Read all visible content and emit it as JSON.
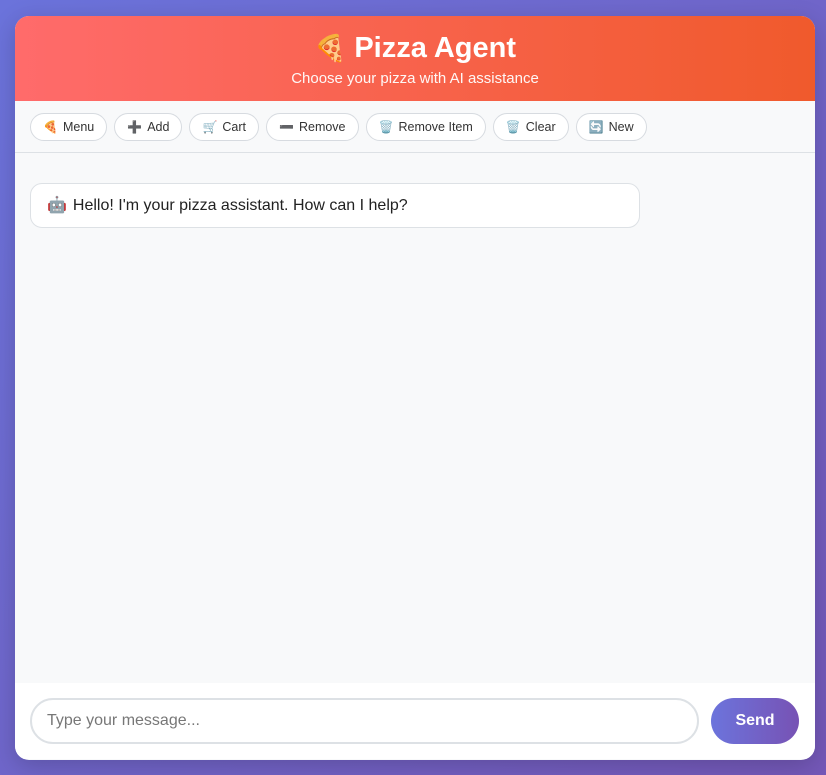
{
  "header": {
    "icon": "pizza-icon",
    "icon_glyph": "🍕",
    "title": "Pizza Agent",
    "subtitle": "Choose your pizza with AI assistance"
  },
  "toolbar": {
    "buttons": [
      {
        "name": "menu",
        "icon": "pizza-icon",
        "glyph": "🍕",
        "label": "Menu"
      },
      {
        "name": "add",
        "icon": "plus-icon",
        "glyph": "➕",
        "label": "Add"
      },
      {
        "name": "cart",
        "icon": "cart-icon",
        "glyph": "🛒",
        "label": "Cart"
      },
      {
        "name": "remove",
        "icon": "minus-icon",
        "glyph": "➖",
        "label": "Remove"
      },
      {
        "name": "remove-item",
        "icon": "trash-icon",
        "glyph": "🗑️",
        "label": "Remove Item"
      },
      {
        "name": "clear",
        "icon": "trash-icon",
        "glyph": "🗑️",
        "label": "Clear"
      },
      {
        "name": "new",
        "icon": "refresh-icon",
        "glyph": "🔄",
        "label": "New"
      }
    ]
  },
  "chat": {
    "messages": [
      {
        "sender": "assistant",
        "icon": "robot-icon",
        "glyph": "🤖",
        "text": "Hello! I'm your pizza assistant. How can I help?"
      }
    ]
  },
  "composer": {
    "placeholder": "Type your message...",
    "value": "",
    "send_label": "Send"
  },
  "colors": {
    "header_gradient_start": "#ff6b6b",
    "header_gradient_end": "#f05a2c",
    "send_gradient_start": "#6c74dc",
    "send_gradient_end": "#7752b4",
    "page_background": "#6b73db"
  }
}
